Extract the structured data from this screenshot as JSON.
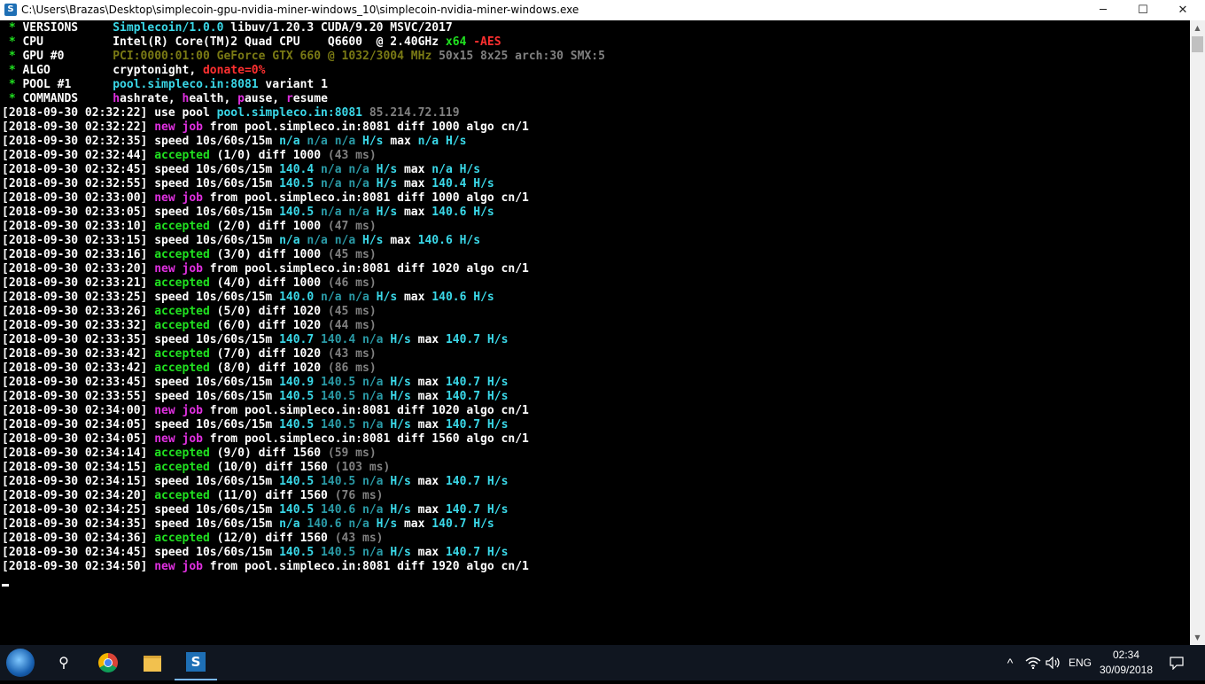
{
  "window": {
    "title": "C:\\Users\\Brazas\\Desktop\\simplecoin-gpu-nvidia-miner-windows_10\\simplecoin-nvidia-miner-windows.exe",
    "controls": {
      "minimize": "─",
      "maximize": "☐",
      "close": "✕"
    }
  },
  "console": {
    "header": [
      {
        "key": "VERSIONS",
        "value_parts": [
          [
            "Simplecoin/1.0.0",
            "c"
          ],
          [
            " libuv/1.20.3 CUDA/9.20 MSVC/2017",
            "w"
          ]
        ]
      },
      {
        "key": "CPU",
        "value_parts": [
          [
            "Intel(R) Core(TM)2 Quad CPU    Q6600  @ 2.40GHz",
            "w"
          ],
          [
            " x64",
            "g"
          ],
          [
            " -AES",
            "r"
          ]
        ]
      },
      {
        "key": "GPU #0",
        "value_parts": [
          [
            "PCI:0000:01:00",
            "dy"
          ],
          [
            " GeForce GTX 660 @ 1032/3004 MHz",
            "dy"
          ],
          [
            " 50x15 8x25 arch:30 SMX:5",
            "gray"
          ]
        ]
      },
      {
        "key": "ALGO",
        "value_parts": [
          [
            "cryptonight, ",
            "w"
          ],
          [
            "donate=0%",
            "r"
          ]
        ]
      },
      {
        "key": "POOL #1",
        "value_parts": [
          [
            "pool.simpleco.in:8081",
            "c"
          ],
          [
            " variant ",
            "w"
          ],
          [
            "1",
            "w"
          ]
        ]
      },
      {
        "key": "COMMANDS",
        "value_parts": [
          [
            "h",
            "m"
          ],
          [
            "ashrate, ",
            "w"
          ],
          [
            "h",
            "m"
          ],
          [
            "ealth, ",
            "w"
          ],
          [
            "p",
            "m"
          ],
          [
            "ause, ",
            "w"
          ],
          [
            "r",
            "m"
          ],
          [
            "esume",
            "w"
          ]
        ]
      }
    ],
    "log": [
      {
        "ts": "2018-09-30 02:32:22",
        "kind": "use",
        "host": "pool.simpleco.in:8081",
        "ip": "85.214.72.119"
      },
      {
        "ts": "2018-09-30 02:32:22",
        "kind": "job",
        "host": "pool.simpleco.in:8081",
        "diff": "1000",
        "algo": "cn/1"
      },
      {
        "ts": "2018-09-30 02:32:35",
        "kind": "speed",
        "s10": "n/a",
        "s60": "n/a",
        "s15": "n/a",
        "max": "n/a"
      },
      {
        "ts": "2018-09-30 02:32:44",
        "kind": "accepted",
        "count": "(1/0)",
        "diff": "1000",
        "ms": "(43 ms)"
      },
      {
        "ts": "2018-09-30 02:32:45",
        "kind": "speed",
        "s10": "140.4",
        "s60": "n/a",
        "s15": "n/a",
        "max": "n/a"
      },
      {
        "ts": "2018-09-30 02:32:55",
        "kind": "speed",
        "s10": "140.5",
        "s60": "n/a",
        "s15": "n/a",
        "max": "140.4"
      },
      {
        "ts": "2018-09-30 02:33:00",
        "kind": "job",
        "host": "pool.simpleco.in:8081",
        "diff": "1000",
        "algo": "cn/1"
      },
      {
        "ts": "2018-09-30 02:33:05",
        "kind": "speed",
        "s10": "140.5",
        "s60": "n/a",
        "s15": "n/a",
        "max": "140.6"
      },
      {
        "ts": "2018-09-30 02:33:10",
        "kind": "accepted",
        "count": "(2/0)",
        "diff": "1000",
        "ms": "(47 ms)"
      },
      {
        "ts": "2018-09-30 02:33:15",
        "kind": "speed",
        "s10": "n/a",
        "s60": "n/a",
        "s15": "n/a",
        "max": "140.6"
      },
      {
        "ts": "2018-09-30 02:33:16",
        "kind": "accepted",
        "count": "(3/0)",
        "diff": "1000",
        "ms": "(45 ms)"
      },
      {
        "ts": "2018-09-30 02:33:20",
        "kind": "job",
        "host": "pool.simpleco.in:8081",
        "diff": "1020",
        "algo": "cn/1"
      },
      {
        "ts": "2018-09-30 02:33:21",
        "kind": "accepted",
        "count": "(4/0)",
        "diff": "1000",
        "ms": "(46 ms)"
      },
      {
        "ts": "2018-09-30 02:33:25",
        "kind": "speed",
        "s10": "140.0",
        "s60": "n/a",
        "s15": "n/a",
        "max": "140.6"
      },
      {
        "ts": "2018-09-30 02:33:26",
        "kind": "accepted",
        "count": "(5/0)",
        "diff": "1020",
        "ms": "(45 ms)"
      },
      {
        "ts": "2018-09-30 02:33:32",
        "kind": "accepted",
        "count": "(6/0)",
        "diff": "1020",
        "ms": "(44 ms)"
      },
      {
        "ts": "2018-09-30 02:33:35",
        "kind": "speed",
        "s10": "140.7",
        "s60": "140.4",
        "s15": "n/a",
        "max": "140.7"
      },
      {
        "ts": "2018-09-30 02:33:42",
        "kind": "accepted",
        "count": "(7/0)",
        "diff": "1020",
        "ms": "(43 ms)"
      },
      {
        "ts": "2018-09-30 02:33:42",
        "kind": "accepted",
        "count": "(8/0)",
        "diff": "1020",
        "ms": "(86 ms)"
      },
      {
        "ts": "2018-09-30 02:33:45",
        "kind": "speed",
        "s10": "140.9",
        "s60": "140.5",
        "s15": "n/a",
        "max": "140.7"
      },
      {
        "ts": "2018-09-30 02:33:55",
        "kind": "speed",
        "s10": "140.5",
        "s60": "140.5",
        "s15": "n/a",
        "max": "140.7"
      },
      {
        "ts": "2018-09-30 02:34:00",
        "kind": "job",
        "host": "pool.simpleco.in:8081",
        "diff": "1020",
        "algo": "cn/1"
      },
      {
        "ts": "2018-09-30 02:34:05",
        "kind": "speed",
        "s10": "140.5",
        "s60": "140.5",
        "s15": "n/a",
        "max": "140.7"
      },
      {
        "ts": "2018-09-30 02:34:05",
        "kind": "job",
        "host": "pool.simpleco.in:8081",
        "diff": "1560",
        "algo": "cn/1"
      },
      {
        "ts": "2018-09-30 02:34:14",
        "kind": "accepted",
        "count": "(9/0)",
        "diff": "1560",
        "ms": "(59 ms)"
      },
      {
        "ts": "2018-09-30 02:34:15",
        "kind": "accepted",
        "count": "(10/0)",
        "diff": "1560",
        "ms": "(103 ms)"
      },
      {
        "ts": "2018-09-30 02:34:15",
        "kind": "speed",
        "s10": "140.5",
        "s60": "140.5",
        "s15": "n/a",
        "max": "140.7"
      },
      {
        "ts": "2018-09-30 02:34:20",
        "kind": "accepted",
        "count": "(11/0)",
        "diff": "1560",
        "ms": "(76 ms)"
      },
      {
        "ts": "2018-09-30 02:34:25",
        "kind": "speed",
        "s10": "140.5",
        "s60": "140.6",
        "s15": "n/a",
        "max": "140.7"
      },
      {
        "ts": "2018-09-30 02:34:35",
        "kind": "speed",
        "s10": "n/a",
        "s60": "140.6",
        "s15": "n/a",
        "max": "140.7"
      },
      {
        "ts": "2018-09-30 02:34:36",
        "kind": "accepted",
        "count": "(12/0)",
        "diff": "1560",
        "ms": "(43 ms)"
      },
      {
        "ts": "2018-09-30 02:34:45",
        "kind": "speed",
        "s10": "140.5",
        "s60": "140.5",
        "s15": "n/a",
        "max": "140.7"
      },
      {
        "ts": "2018-09-30 02:34:50",
        "kind": "job",
        "host": "pool.simpleco.in:8081",
        "diff": "1920",
        "algo": "cn/1"
      }
    ],
    "words": {
      "use_pool": "use pool",
      "new": "new",
      "job": "job",
      "from": "from",
      "diff": "diff",
      "algo": "algo",
      "speed": "speed",
      "windows": "10s/60s/15m",
      "hs": "H/s",
      "max": "max",
      "accepted": "accepted"
    }
  },
  "taskbar": {
    "search_icon": "⚲",
    "app_letter": "S",
    "tray": {
      "chevron": "^",
      "network_icon": "wifi-icon",
      "volume_icon": "speaker-icon",
      "language": "ENG",
      "time": "02:34",
      "date": "30/09/2018",
      "notification_icon": "notification-icon"
    }
  }
}
